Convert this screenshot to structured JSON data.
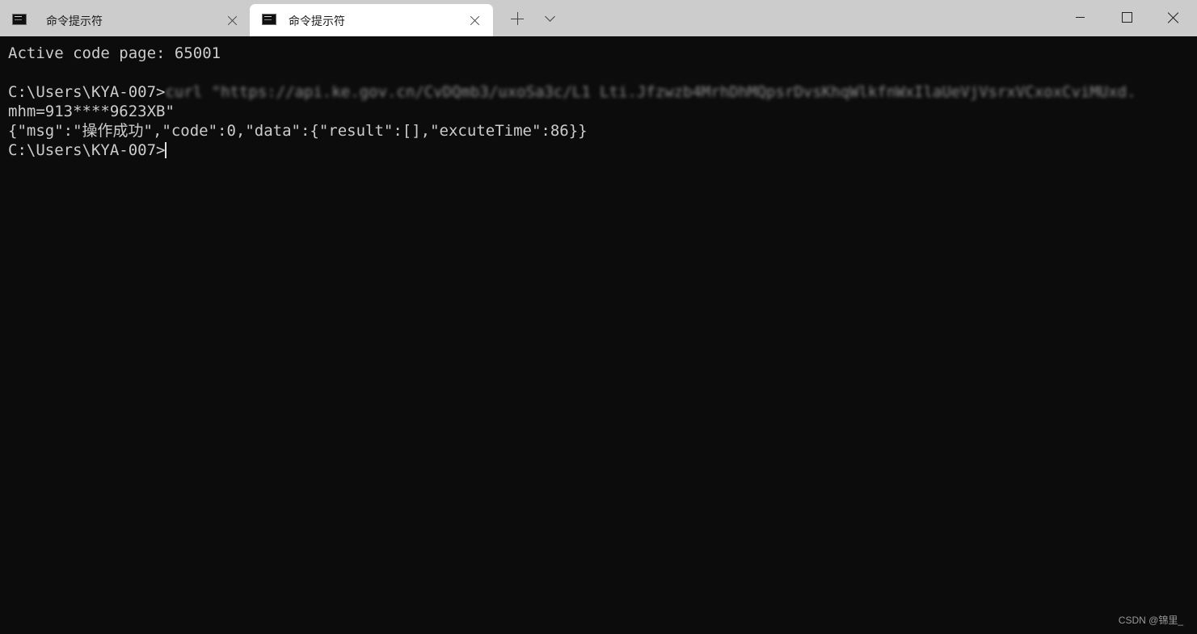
{
  "window": {
    "tabs": [
      {
        "title": "命令提示符",
        "active": false
      },
      {
        "title": "命令提示符",
        "active": true
      }
    ],
    "colors": {
      "titlebar": "#cccccc",
      "active_tab": "#ffffff",
      "terminal_bg": "#0c0c0c",
      "terminal_fg": "#cccccc"
    },
    "icons": {
      "tab": "cmd-icon",
      "close_tab": "close-icon",
      "new_tab": "plus-icon",
      "dropdown": "chevron-down-icon",
      "minimize": "minimize-icon",
      "maximize": "maximize-icon",
      "close_window": "close-icon"
    }
  },
  "terminal": {
    "line1": "Active code page: 65001",
    "line2": "",
    "line3_prompt": "C:\\Users\\KYA-007>",
    "line3_blurred": "curl \"https://api.ke.gov.cn/CvDQmb3/uxoSa3c/L1 Lti.Jfzwzb4MrhDhMQpsrDvsKhqWlkfnWxIlaUeVjVsrxVCxoxCviMUxd.",
    "line4": "mhm=913****9623XB\"",
    "line5": "{\"msg\":\"操作成功\",\"code\":0,\"data\":{\"result\":[],\"excuteTime\":86}}",
    "line6_prompt": "C:\\Users\\KYA-007>"
  },
  "watermark": "CSDN @锦里_"
}
